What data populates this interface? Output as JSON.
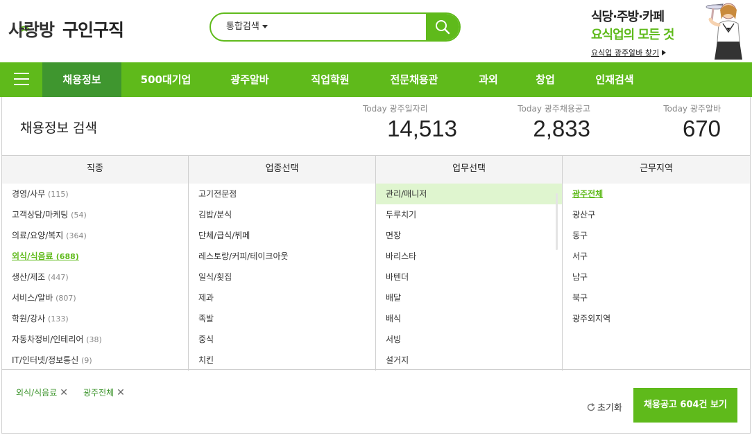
{
  "header": {
    "logo_main": "사랑방",
    "logo_sub": "구인구직",
    "search": {
      "type_label": "통합검색",
      "placeholder": "",
      "value": ""
    },
    "promo": {
      "line1": "식당·주방·카페",
      "line2": "요식업의 모든 것",
      "link": "요식업 광주알바 찾기"
    }
  },
  "nav": {
    "items": [
      {
        "label": "채용정보",
        "active": true
      },
      {
        "label": "500대기업"
      },
      {
        "label": "광주알바"
      },
      {
        "label": "직업학원"
      },
      {
        "label": "전문채용관"
      },
      {
        "label": "과외"
      },
      {
        "label": "창업"
      },
      {
        "label": "인재검색"
      }
    ]
  },
  "panel": {
    "title": "채용정보 검색",
    "stats": [
      {
        "label": "Today 광주일자리",
        "value": "14,513"
      },
      {
        "label": "Today 광주채용공고",
        "value": "2,833"
      },
      {
        "label": "Today 광주알바",
        "value": "670"
      }
    ]
  },
  "columns": [
    {
      "header": "직종",
      "items": [
        {
          "label": "경영/사무",
          "count": "(115)"
        },
        {
          "label": "고객상담/마케팅",
          "count": "(54)"
        },
        {
          "label": "의료/요양/복지",
          "count": "(364)"
        },
        {
          "label": "외식/식음료",
          "count": "(688)",
          "selected": true
        },
        {
          "label": "생산/제조",
          "count": "(447)"
        },
        {
          "label": "서비스/알바",
          "count": "(807)"
        },
        {
          "label": "학원/강사",
          "count": "(133)"
        },
        {
          "label": "자동차정비/인테리어",
          "count": "(38)"
        },
        {
          "label": "IT/인터넷/정보통신",
          "count": "(9)"
        }
      ]
    },
    {
      "header": "업종선택",
      "items": [
        {
          "label": "고기전문점"
        },
        {
          "label": "김밥/분식"
        },
        {
          "label": "단체/급식/뷔페"
        },
        {
          "label": "레스토랑/커피/테이크아웃"
        },
        {
          "label": "일식/횟집"
        },
        {
          "label": "제과"
        },
        {
          "label": "족발"
        },
        {
          "label": "중식"
        },
        {
          "label": "치킨"
        }
      ]
    },
    {
      "header": "업무선택",
      "items": [
        {
          "label": "관리/매니저",
          "highlight": true
        },
        {
          "label": "두루치기"
        },
        {
          "label": "면장"
        },
        {
          "label": "바리스타"
        },
        {
          "label": "바텐더"
        },
        {
          "label": "배달"
        },
        {
          "label": "배식"
        },
        {
          "label": "서빙"
        },
        {
          "label": "설거지"
        }
      ]
    },
    {
      "header": "근무지역",
      "items": [
        {
          "label": "광주전체",
          "selected": true
        },
        {
          "label": "광산구"
        },
        {
          "label": "동구"
        },
        {
          "label": "서구"
        },
        {
          "label": "남구"
        },
        {
          "label": "북구"
        },
        {
          "label": "광주외지역"
        }
      ]
    }
  ],
  "footer": {
    "chips": [
      {
        "label": "외식/식음료"
      },
      {
        "label": "광주전체"
      }
    ],
    "reset_label": "초기화",
    "submit_label": "채용공고 604건 보기"
  },
  "colors": {
    "brand": "#5fba1b",
    "brand_dark": "#3f962f",
    "highlight": "#dff5cf"
  }
}
